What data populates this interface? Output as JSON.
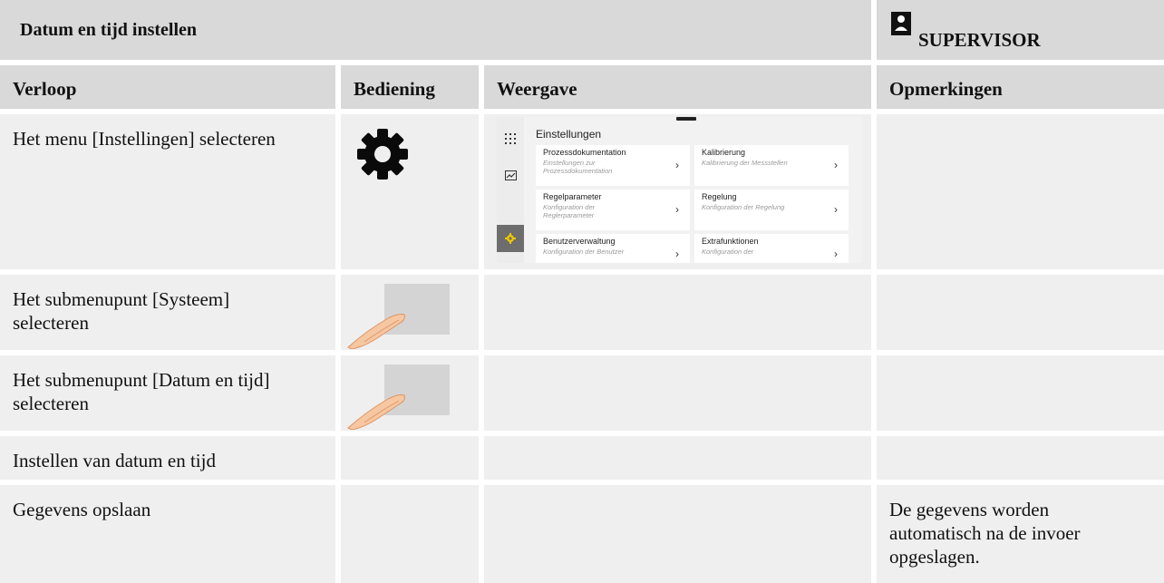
{
  "title": "Datum en tijd instellen",
  "role": "SUPERVISOR",
  "headers": {
    "verloop": "Verloop",
    "bediening": "Bediening",
    "weergave": "Weergave",
    "opmerkingen": "Opmerkingen"
  },
  "rows": [
    {
      "verloop": "Het menu [Instellingen] selecteren",
      "bediening_icon": "gear-icon",
      "opmerkingen": ""
    },
    {
      "verloop": "Het submenupunt [Systeem] selecteren",
      "bediening_icon": "finger-touch-icon",
      "opmerkingen": ""
    },
    {
      "verloop": "Het submenupunt [Datum en tijd] selecteren",
      "bediening_icon": "finger-touch-icon",
      "opmerkingen": ""
    },
    {
      "verloop": "Instellen van datum en tijd",
      "bediening_icon": "",
      "opmerkingen": ""
    },
    {
      "verloop": "Gegevens opslaan",
      "bediening_icon": "",
      "opmerkingen": "De gegevens worden automatisch na de invoer opgeslagen."
    }
  ],
  "screen": {
    "heading": "Einstellungen",
    "tiles": [
      {
        "title": "Prozessdokumentation",
        "subtitle": "Einstellungen zur Prozessdokumentation"
      },
      {
        "title": "Kalibrierung",
        "subtitle": "Kalibrierung der Messstellen"
      },
      {
        "title": "Regelparameter",
        "subtitle": "Konfiguration der Reglerparameter"
      },
      {
        "title": "Regelung",
        "subtitle": "Konfiguration der Regelung"
      },
      {
        "title": "Benutzerverwaltung",
        "subtitle": "Konfiguration der Benutzer"
      },
      {
        "title": "Extrafunktionen",
        "subtitle": "Konfiguration der"
      }
    ],
    "chevron": "›",
    "rail_icons": [
      "grid-icon",
      "chart-icon",
      "settings-icon"
    ]
  },
  "colors": {
    "header_bg": "#d9d9d9",
    "cell_bg": "#efefef",
    "active_rail": "#6d6d6d",
    "active_icon": "#f0c800"
  }
}
